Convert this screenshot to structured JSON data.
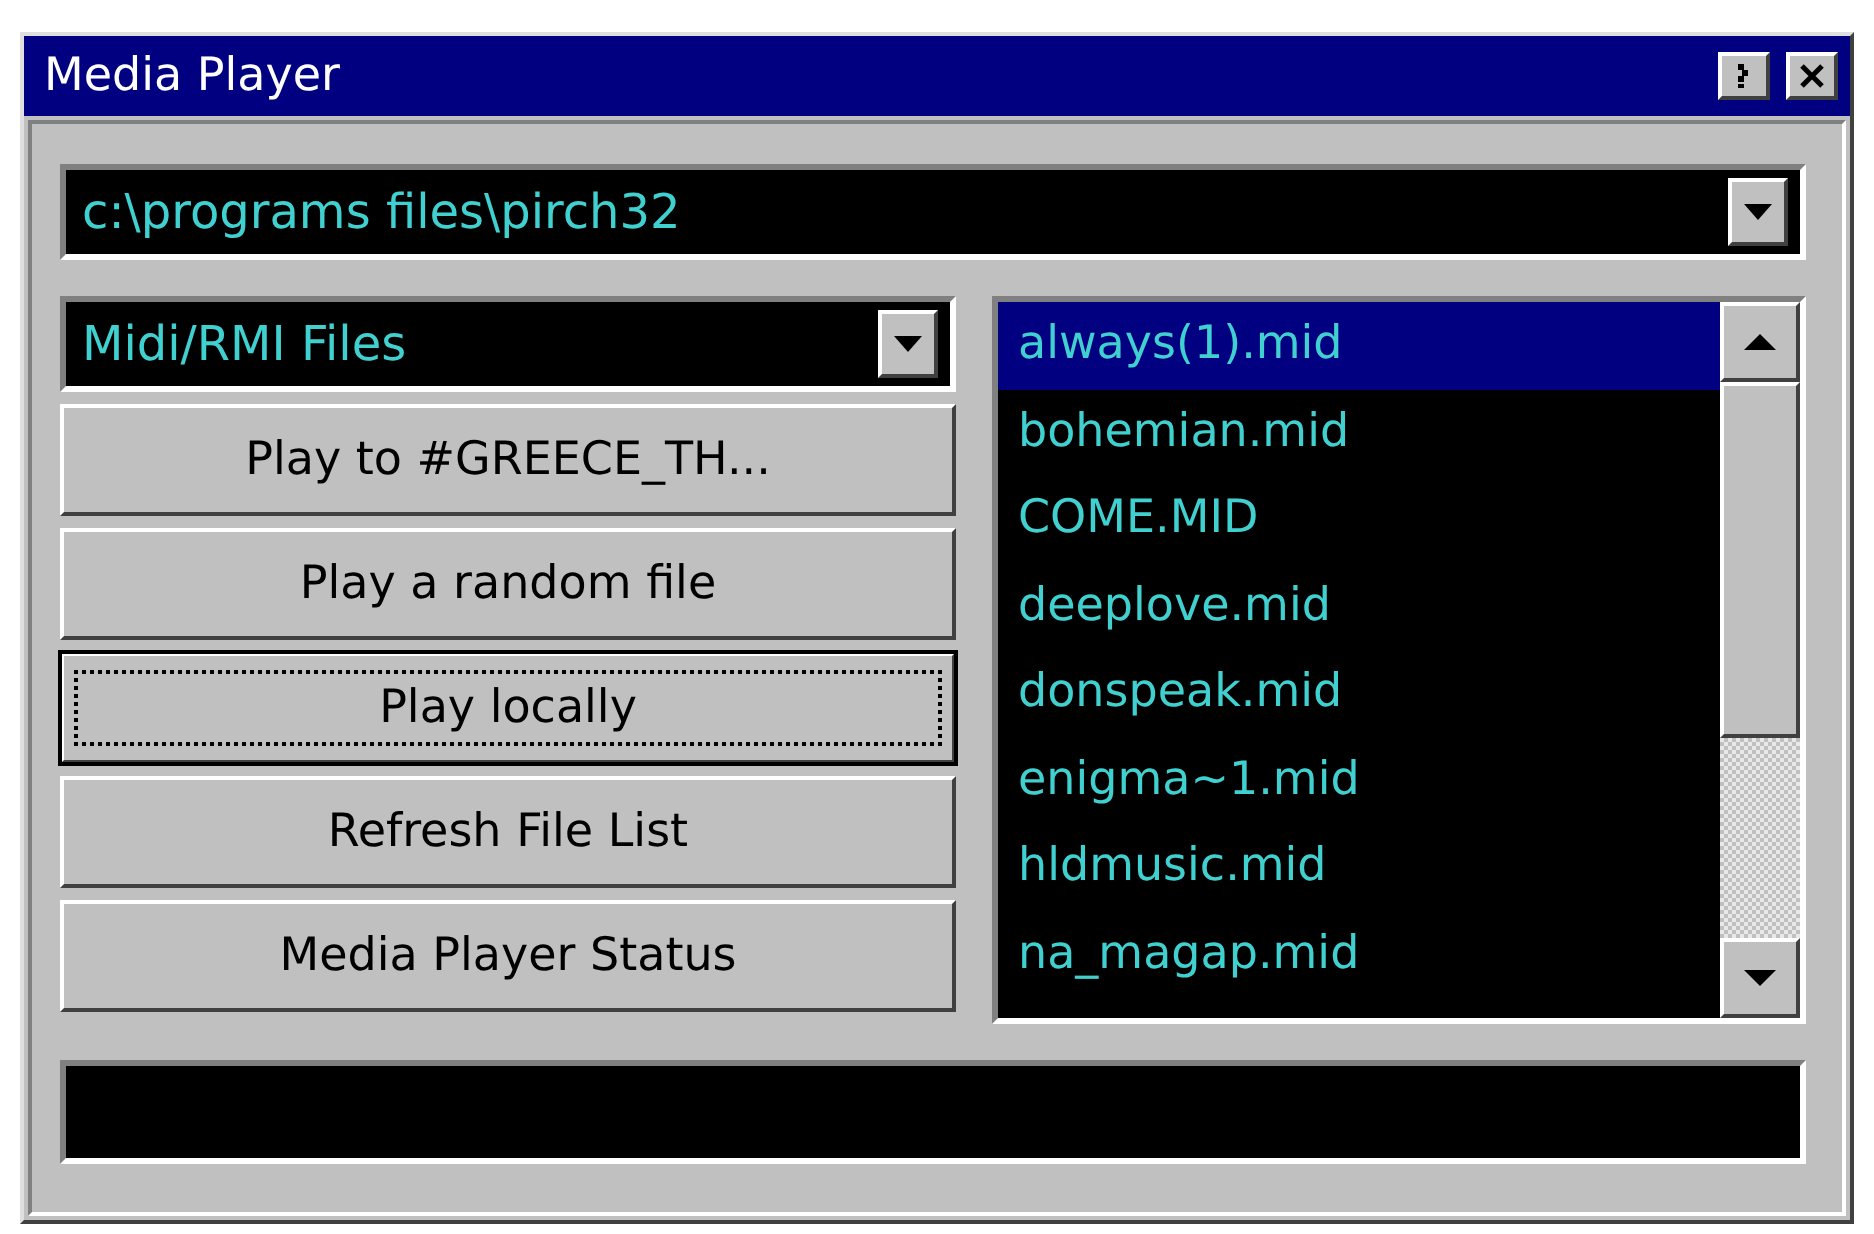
{
  "window": {
    "title": "Media Player"
  },
  "title_buttons": [
    {
      "kind": "help"
    },
    {
      "kind": "close"
    }
  ],
  "path_combo": {
    "value": "c:\\programs files\\pirch32"
  },
  "type_combo": {
    "value": "Midi/RMI Files"
  },
  "buttons": [
    {
      "label": "Play to #GREECE_TH...",
      "focused": false
    },
    {
      "label": "Play a random file",
      "focused": false
    },
    {
      "label": "Play locally",
      "focused": true
    },
    {
      "label": "Refresh File List",
      "focused": false
    },
    {
      "label": "Media Player Status",
      "focused": false
    }
  ],
  "files": [
    {
      "name": "always(1).mid",
      "selected": true
    },
    {
      "name": "bohemian.mid",
      "selected": false
    },
    {
      "name": "COME.MID",
      "selected": false
    },
    {
      "name": "deeplove.mid",
      "selected": false
    },
    {
      "name": "donspeak.mid",
      "selected": false
    },
    {
      "name": "enigma~1.mid",
      "selected": false
    },
    {
      "name": "hldmusic.mid",
      "selected": false
    },
    {
      "name": "na_magap.mid",
      "selected": false
    }
  ]
}
